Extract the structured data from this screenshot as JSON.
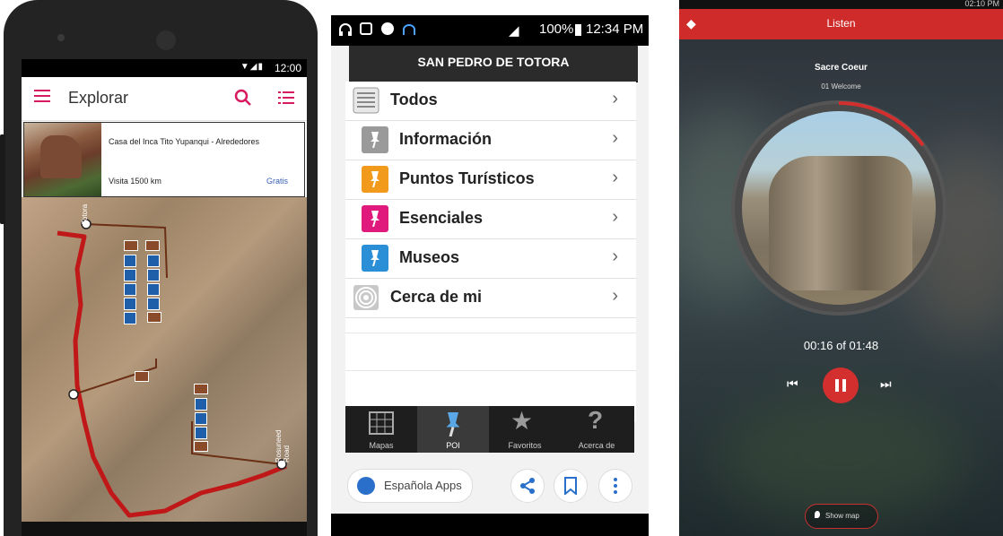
{
  "explore_app": {
    "status_time": "12:00",
    "appbar_title": "Explorar",
    "card": {
      "title": "Casa del Inca Tito Yupanqui - Alrededores",
      "visit": "Visita 1500 km",
      "price": "Gratis"
    },
    "map_labels": [
      "Totora",
      "Rosuneed Road"
    ],
    "icons": [
      "menu-icon",
      "search-icon",
      "list-icon"
    ]
  },
  "poi_app": {
    "status_battery": "100%",
    "status_time": "12:34 PM",
    "header_title": "SAN PEDRO DE TOTORA",
    "items": [
      {
        "label": "Todos",
        "icon": "list-icon",
        "color": "#9a9a9a"
      },
      {
        "label": "Información",
        "icon": "pin-icon",
        "color": "#8f8f8f"
      },
      {
        "label": "Puntos Turísticos",
        "icon": "pin-icon",
        "color": "#f29a1c"
      },
      {
        "label": "Esenciales",
        "icon": "pin-icon",
        "color": "#e0197d"
      },
      {
        "label": "Museos",
        "icon": "pin-icon",
        "color": "#2a8fd6"
      },
      {
        "label": "Cerca de mi",
        "icon": "radar-icon",
        "color": "#b0b0b0"
      }
    ],
    "tabs": [
      {
        "label": "Mapas",
        "icon": "map-icon"
      },
      {
        "label": "POI",
        "icon": "pin-icon"
      },
      {
        "label": "Favoritos",
        "icon": "star-icon"
      },
      {
        "label": "Acerca de",
        "icon": "question-icon"
      }
    ],
    "bottom_button": "Española Apps"
  },
  "listen_app": {
    "status_text": "02:10 PM",
    "title": "Listen",
    "place_name": "Sacre Coeur",
    "track": "01 Welcome",
    "elapsed": "00:16",
    "timer_text": "00:16 of 01:48",
    "total": "01:48",
    "show_map": "Show map",
    "accent": "#cf2b2b"
  }
}
